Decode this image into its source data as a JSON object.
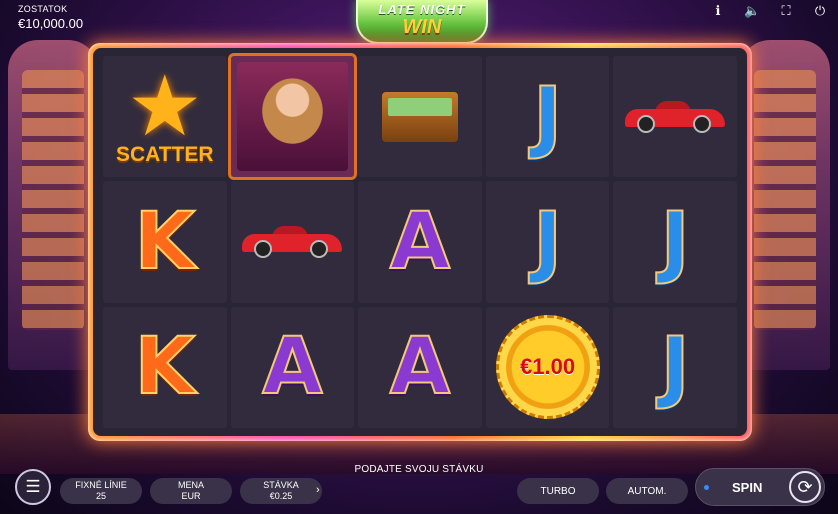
{
  "balance": {
    "label": "ZOSTATOK",
    "value": "€10,000.00"
  },
  "top_icons": [
    "info-icon",
    "sound-icon",
    "fullscreen-icon",
    "power-icon"
  ],
  "logo": {
    "line1": "LATE NIGHT",
    "line2": "WIN"
  },
  "reels": [
    [
      "scatter",
      "woman",
      "money",
      "J",
      "car"
    ],
    [
      "K",
      "car",
      "A",
      "J",
      "J"
    ],
    [
      "K",
      "A",
      "A",
      "chip",
      "J"
    ]
  ],
  "scatter_text": "SCATTER",
  "chip_value": "€1.00",
  "prompt": "PODAJTE SVOJU STÁVKU",
  "controls": {
    "lines_label": "FIXNÉ LÍNIE",
    "lines_value": "25",
    "currency_label": "MENA",
    "currency_value": "EUR",
    "bet_label": "STÁVKA",
    "bet_value": "€0.25",
    "turbo_label": "TURBO",
    "auto_label": "AUTOM.",
    "spin_label": "SPIN"
  }
}
